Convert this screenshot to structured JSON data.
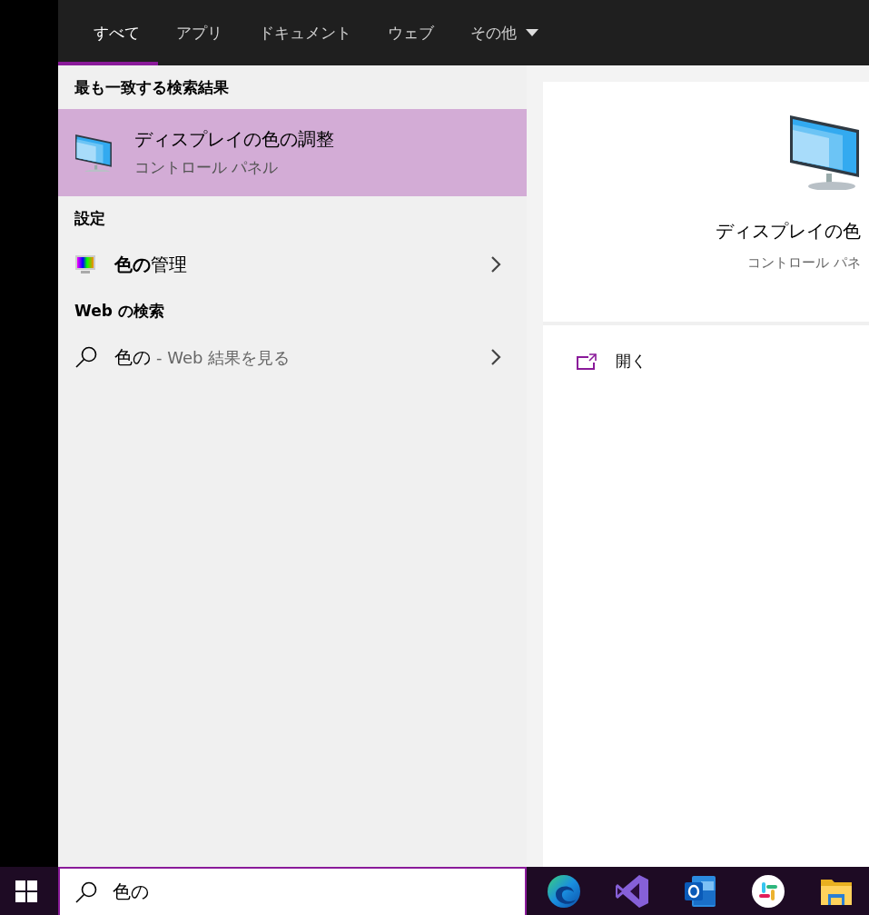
{
  "tabs": [
    {
      "label": "すべて",
      "selected": true,
      "dropdown": false
    },
    {
      "label": "アプリ",
      "selected": false,
      "dropdown": false
    },
    {
      "label": "ドキュメント",
      "selected": false,
      "dropdown": false
    },
    {
      "label": "ウェブ",
      "selected": false,
      "dropdown": false
    },
    {
      "label": "その他",
      "selected": false,
      "dropdown": true
    }
  ],
  "results": {
    "sections": [
      {
        "heading": "最も一致する検索結果",
        "items": [
          {
            "kind": "best",
            "title": "ディスプレイの色の調整",
            "subtitle": "コントロール パネル",
            "selected": true
          }
        ]
      },
      {
        "heading": "設定",
        "items": [
          {
            "kind": "setting",
            "title": "**色の**管理",
            "selected": false
          }
        ]
      },
      {
        "heading": "Web の検索",
        "items": [
          {
            "kind": "web",
            "query": "色の",
            "suffix": "- Web 結果を見る",
            "selected": false
          }
        ]
      }
    ]
  },
  "detail": {
    "title": "ディスプレイの色",
    "subtitle": "コントロール パネ",
    "actions": [
      {
        "label": "開く"
      }
    ]
  },
  "taskbar": {
    "search": {
      "value": "色の"
    },
    "apps": [
      {
        "kind": "swirl"
      },
      {
        "kind": "ribbon"
      },
      {
        "kind": "mail"
      },
      {
        "kind": "pinwheel"
      },
      {
        "kind": "folder"
      }
    ]
  }
}
